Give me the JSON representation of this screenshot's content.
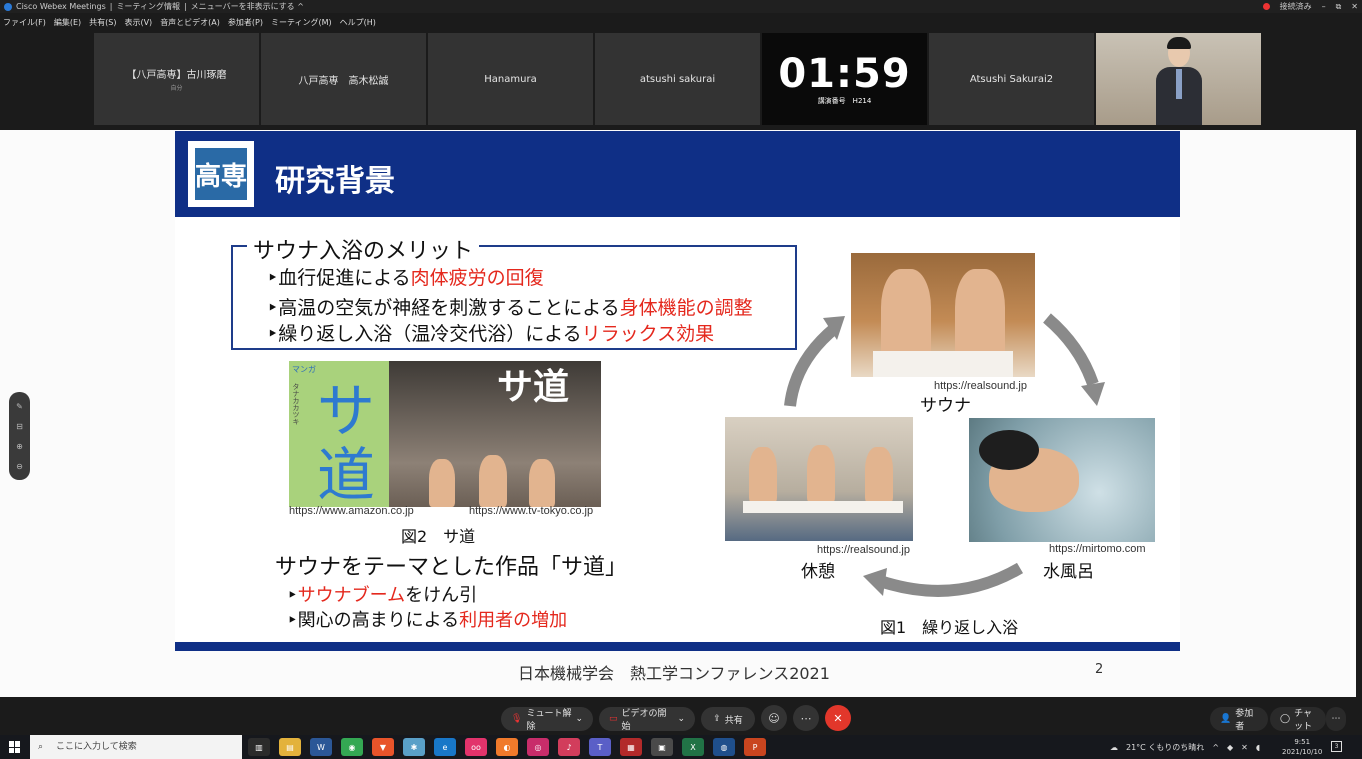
{
  "window": {
    "app_title": "Cisco Webex Meetings",
    "meeting_info": "ミーティング情報",
    "hide_menu": "メニューバーを非表示にする ^",
    "status": "接続済み",
    "minimize": "–",
    "restore": "⧉",
    "close": "✕"
  },
  "menu": [
    "ファイル(F)",
    "編集(E)",
    "共有(S)",
    "表示(V)",
    "音声とビデオ(A)",
    "参加者(P)",
    "ミーティング(M)",
    "ヘルプ(H)"
  ],
  "participants": [
    {
      "name": "【八戸高専】古川琢磨",
      "sub": "自分"
    },
    {
      "name": "八戸高専　高木松誠",
      "sub": ""
    },
    {
      "name": "Hanamura",
      "sub": ""
    },
    {
      "name": "atsushi sakurai",
      "sub": ""
    }
  ],
  "timer": {
    "time": "01:59",
    "caption": "講演番号　H214"
  },
  "participant_last": {
    "name": "Atsushi Sakurai2"
  },
  "slide": {
    "logo_text": "高専",
    "title": "研究背景",
    "merit_title": "サウナ入浴のメリット",
    "merits": [
      {
        "pre": "‣血行促進による",
        "hl": "肉体疲労の回復"
      },
      {
        "pre": "‣高温の空気が神経を刺激することによる",
        "hl": "身体機能の調整"
      },
      {
        "pre": "‣繰り返し入浴（温冷交代浴）による",
        "hl": "リラックス効果"
      }
    ],
    "manga_cover_text": "サ道",
    "manga_photo_text": "サ道",
    "manga_small_1": "マンガ",
    "manga_small_2": "タナカカツキ",
    "url_amazon": "https://www.amazon.co.jp",
    "url_tvtokyo": "https://www.tv-tokyo.co.jp",
    "fig2": "図2　サ道",
    "sadou_title": "サウナをテーマとした作品「サ道」",
    "sadou_points": [
      {
        "pre": "‣",
        "hl": "サウナブーム",
        "post": "をけん引"
      },
      {
        "pre": "‣関心の高まりによる",
        "hl": "利用者の増加",
        "post": ""
      }
    ],
    "url_sauna": "https://realsound.jp",
    "label_sauna": "サウナ",
    "url_rest": "https://realsound.jp",
    "label_rest": "休憩",
    "url_water": "https://mirtomo.com",
    "label_water": "水風呂",
    "fig1": "図1　繰り返し入浴",
    "footer": "日本機械学会　熱工学コンファレンス2021",
    "page_number": "2",
    "colors": {
      "navy": "#0f2f86",
      "highlight": "#e4281d"
    }
  },
  "side_tools": [
    "✎",
    "⊟",
    "⊕",
    "⊖"
  ],
  "controls": {
    "mute": "ミュート解除",
    "video": "ビデオの開始",
    "share": "共有",
    "reaction": "☺",
    "more": "⋯",
    "end": "✕",
    "participants": "参加者",
    "chat": "チャット",
    "more_right": "⋯"
  },
  "taskbar": {
    "search_placeholder": "ここに入力して検索",
    "weather": "21°C くもりのち晴れ",
    "time": "9:51",
    "date": "2021/10/10"
  }
}
